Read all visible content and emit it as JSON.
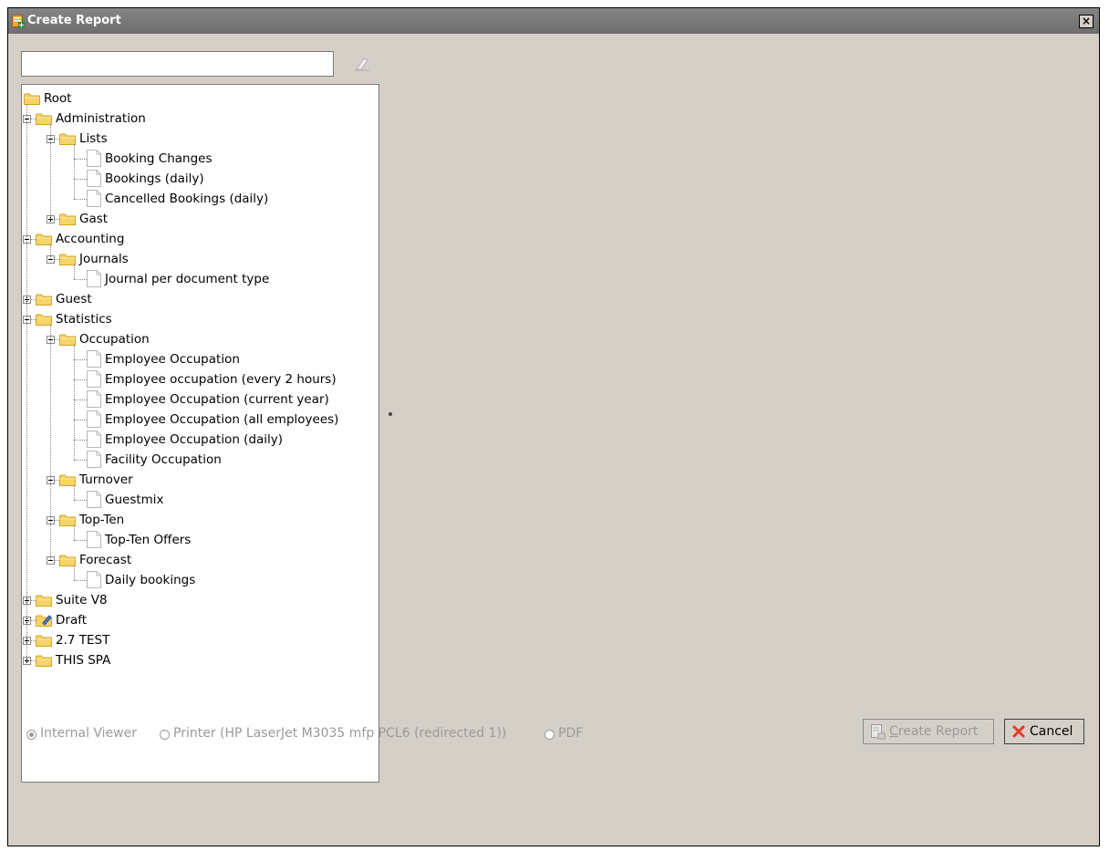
{
  "window": {
    "title": "Create Report"
  },
  "search": {
    "value": "",
    "placeholder": ""
  },
  "tree": {
    "root": "Root",
    "administration": "Administration",
    "lists": "Lists",
    "booking_changes": "Booking Changes",
    "bookings_daily": "Bookings (daily)",
    "cancelled_bookings": "Cancelled Bookings (daily)",
    "gast": "Gast",
    "accounting": "Accounting",
    "journals": "Journals",
    "journal_per_doc": "Journal per document type",
    "guest": "Guest",
    "statistics": "Statistics",
    "occupation": "Occupation",
    "emp_occ": "Employee Occupation",
    "emp_occ_2h": "Employee occupation (every 2 hours)",
    "emp_occ_year": "Employee Occupation (current year)",
    "emp_occ_all": "Employee Occupation (all employees)",
    "emp_occ_daily": "Employee Occupation (daily)",
    "facility_occ": "Facility Occupation",
    "turnover": "Turnover",
    "guestmix": "Guestmix",
    "topten": "Top-Ten",
    "topten_offers": "Top-Ten Offers",
    "forecast": "Forecast",
    "daily_bookings": "Daily bookings",
    "suite_v8": "Suite V8",
    "draft": "Draft",
    "test27": "2.7 TEST",
    "this_spa": "THIS SPA"
  },
  "output": {
    "internal_viewer": "Internal Viewer",
    "printer": "Printer (HP LaserJet M3035 mfp PCL6 (redirected 1))",
    "pdf": "PDF",
    "selected": "Internal Viewer"
  },
  "buttons": {
    "create_mnemonic": "C",
    "create_rest": "reate Report",
    "cancel": "Cancel"
  },
  "colors": {
    "titlebar": "#7a7a7a",
    "dialog_bg": "#d4d0c8",
    "folder": "#f5d46a",
    "cancel_x": "#e23a2a"
  }
}
